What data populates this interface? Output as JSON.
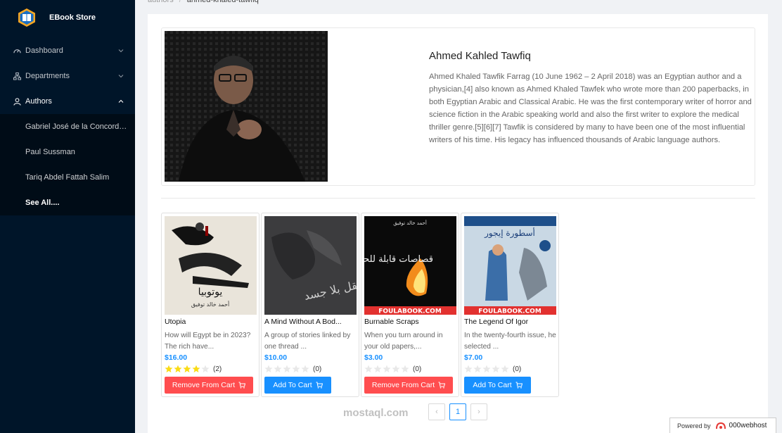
{
  "app": {
    "title": "EBook Store"
  },
  "sidebar": {
    "items": [
      {
        "label": "Dashboard",
        "icon": "dashboard-icon"
      },
      {
        "label": "Departments",
        "icon": "departments-icon"
      },
      {
        "label": "Authors",
        "icon": "user-icon"
      }
    ],
    "authors_submenu": [
      "Gabriel José de la Concordia ...",
      "Paul Sussman",
      "Tariq Abdel Fattah Salim",
      "See All...."
    ]
  },
  "breadcrumb": {
    "parent": "authors",
    "separator": "/",
    "current": "ahmed-khaled-tawfiq"
  },
  "author": {
    "name": "Ahmed Kahled Tawfiq",
    "bio": "Ahmed Khaled Tawfik Farrag (10 June 1962 – 2 April 2018) was an Egyptian author and a physician,[4] also known as Ahmed Khaled Tawfek who wrote more than 200 paperbacks, in both Egyptian Arabic and Classical Arabic. He was the first contemporary writer of horror and science fiction in the Arabic speaking world and also the first writer to explore the medical thriller genre.[5][6][7] Tawfik is considered by many to have been one of the most influential writers of his time. His legacy has influenced thousands of Arabic language authors."
  },
  "books": [
    {
      "title": "Utopia",
      "description": "How will Egypt be in 2023? The rich have...",
      "price": "$16.00",
      "rating": 4,
      "rating_count": "(2)",
      "button": "Remove From Cart",
      "in_cart": true,
      "cover_text": "يوتوبيا",
      "cover_author": "أحمد خالد توفيق"
    },
    {
      "title": "A Mind Without A Bod...",
      "description": "A group of stories linked by one thread ...",
      "price": "$10.00",
      "rating": 0,
      "rating_count": "(0)",
      "button": "Add To Cart",
      "in_cart": false,
      "cover_text": "عقل بلا جسد",
      "cover_author": ""
    },
    {
      "title": "Burnable Scraps",
      "description": "When you turn around in your old papers,...",
      "price": "$3.00",
      "rating": 0,
      "rating_count": "(0)",
      "button": "Remove From Cart",
      "in_cart": true,
      "cover_text": "قصاصات قابلة للحرق",
      "cover_author": "أحمد خالد توفيق",
      "cover_footer": "FOULABOOK.COM"
    },
    {
      "title": "The Legend Of Igor",
      "description": "In the twenty-fourth issue, he selected ...",
      "price": "$7.00",
      "rating": 0,
      "rating_count": "(0)",
      "button": "Add To Cart",
      "in_cart": false,
      "cover_text": "أسطورة إيجور",
      "cover_author": "",
      "cover_footer": "FOULABOOK.COM"
    }
  ],
  "pagination": {
    "prev": "‹",
    "page": "1",
    "next": "›"
  },
  "watermark": "mostaql.com",
  "footer": {
    "powered_by": "Powered by",
    "host": "000webhost"
  },
  "colors": {
    "sidebar": "#001529",
    "primary": "#1890ff",
    "danger": "#ff4d4f",
    "star": "#fadb14"
  }
}
